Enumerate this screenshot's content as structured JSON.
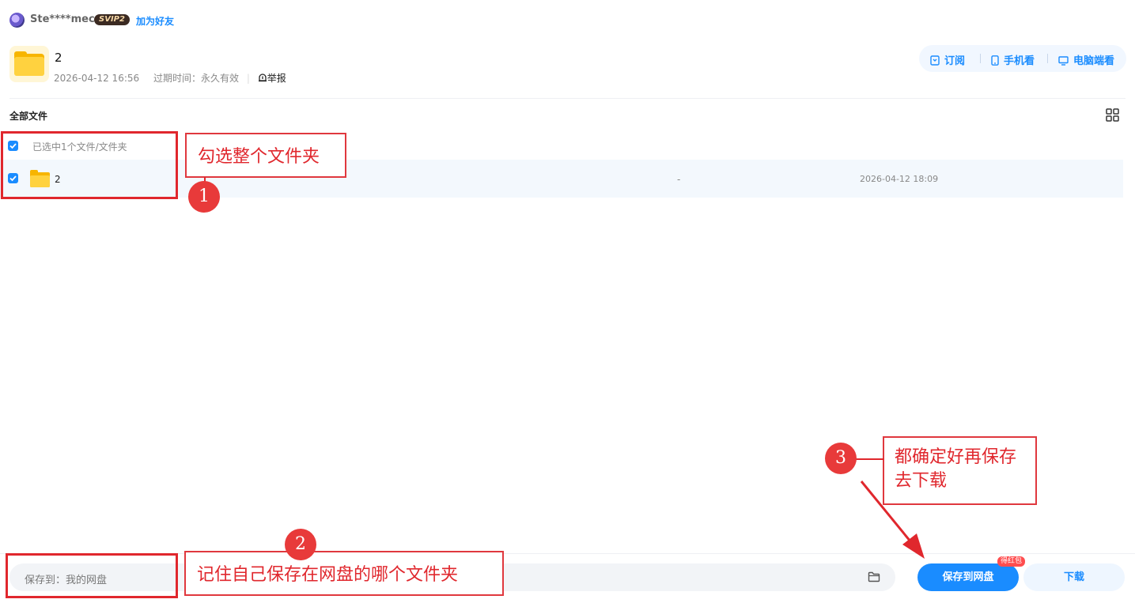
{
  "user": {
    "name": "Ste****mecn",
    "vip_badge": "SVIP2",
    "add_friend": "加为好友"
  },
  "share": {
    "title": "2",
    "created": "2026-04-12 16:56",
    "expire": "过期时间：永久有效",
    "report": "举报",
    "actions": [
      "订阅",
      "手机看",
      "电脑端看"
    ]
  },
  "breadcrumb": "全部文件",
  "list": {
    "selected_text": "已选中1个文件/文件夹",
    "rows": [
      {
        "name": "2",
        "size": "-",
        "date": "2026-04-12 18:09"
      }
    ]
  },
  "bottom": {
    "save_to": "保存到：我的网盘",
    "save_button": "保存到网盘",
    "badge": "得红包",
    "download_button": "下载"
  },
  "annotations": {
    "note1": "勾选整个文件夹",
    "note2": "记住自己保存在网盘的哪个文件夹",
    "note3_line1": "都确定好再保存",
    "note3_line2": "去下载",
    "num1": "1",
    "num2": "2",
    "num3": "3",
    "color": "#e0272d"
  },
  "colors": {
    "accent": "#1a8cff",
    "folder": "#ffd23f"
  }
}
